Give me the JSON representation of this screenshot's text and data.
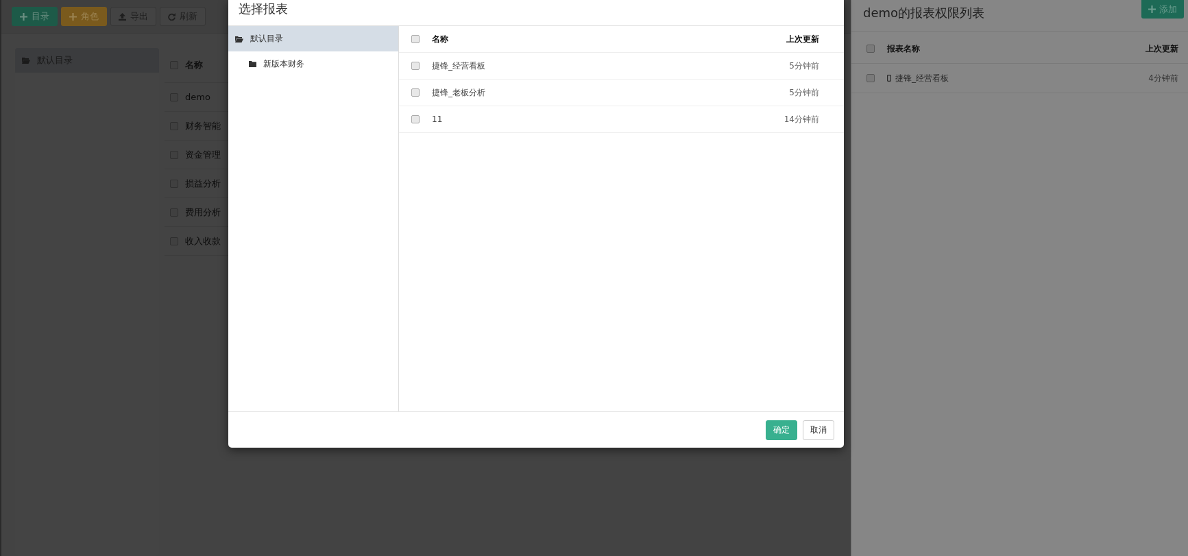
{
  "toolbar": {
    "buttons": [
      {
        "kind": "success",
        "label": "目录"
      },
      {
        "kind": "warning",
        "label": "角色"
      },
      {
        "kind": "default",
        "label": "导出"
      },
      {
        "kind": "default",
        "label": "刷新"
      }
    ]
  },
  "sidebar": {
    "items": [
      {
        "label": "默认目录",
        "selected": true
      }
    ]
  },
  "table": {
    "header": {
      "label": "名称",
      "checked": false
    },
    "rows": [
      {
        "name": "demo",
        "checked": false
      },
      {
        "name": "财务智能",
        "checked": false
      },
      {
        "name": "资金管理",
        "checked": false
      },
      {
        "name": "损益分析",
        "checked": false
      },
      {
        "name": "费用分析",
        "checked": false
      },
      {
        "name": "收入收款",
        "checked": false
      }
    ]
  },
  "right_panel": {
    "title": "demo的报表权限列表",
    "add_button": "添加",
    "columns": [
      "报表名称",
      "上次更新"
    ],
    "header_checked": false,
    "rows": [
      {
        "name": "捷锋_经营看板",
        "updated": "4分钟前",
        "checked": false
      }
    ]
  },
  "dialog": {
    "title": "选择报表",
    "tree": [
      {
        "label": "默认目录",
        "selected": true,
        "expanded": true,
        "children": [
          {
            "label": "新版本财务",
            "selected": false
          }
        ]
      }
    ],
    "columns": [
      "名称",
      "上次更新"
    ],
    "header_checked": false,
    "rows": [
      {
        "name": "捷锋_经营看板",
        "updated": "5分钟前",
        "checked": false
      },
      {
        "name": "捷锋_老板分析",
        "updated": "5分钟前",
        "checked": false
      },
      {
        "name": "11",
        "updated": "14分钟前",
        "checked": false
      }
    ],
    "buttons": [
      {
        "kind": "primary",
        "label": "确定"
      },
      {
        "kind": "default",
        "label": "取消"
      }
    ]
  }
}
